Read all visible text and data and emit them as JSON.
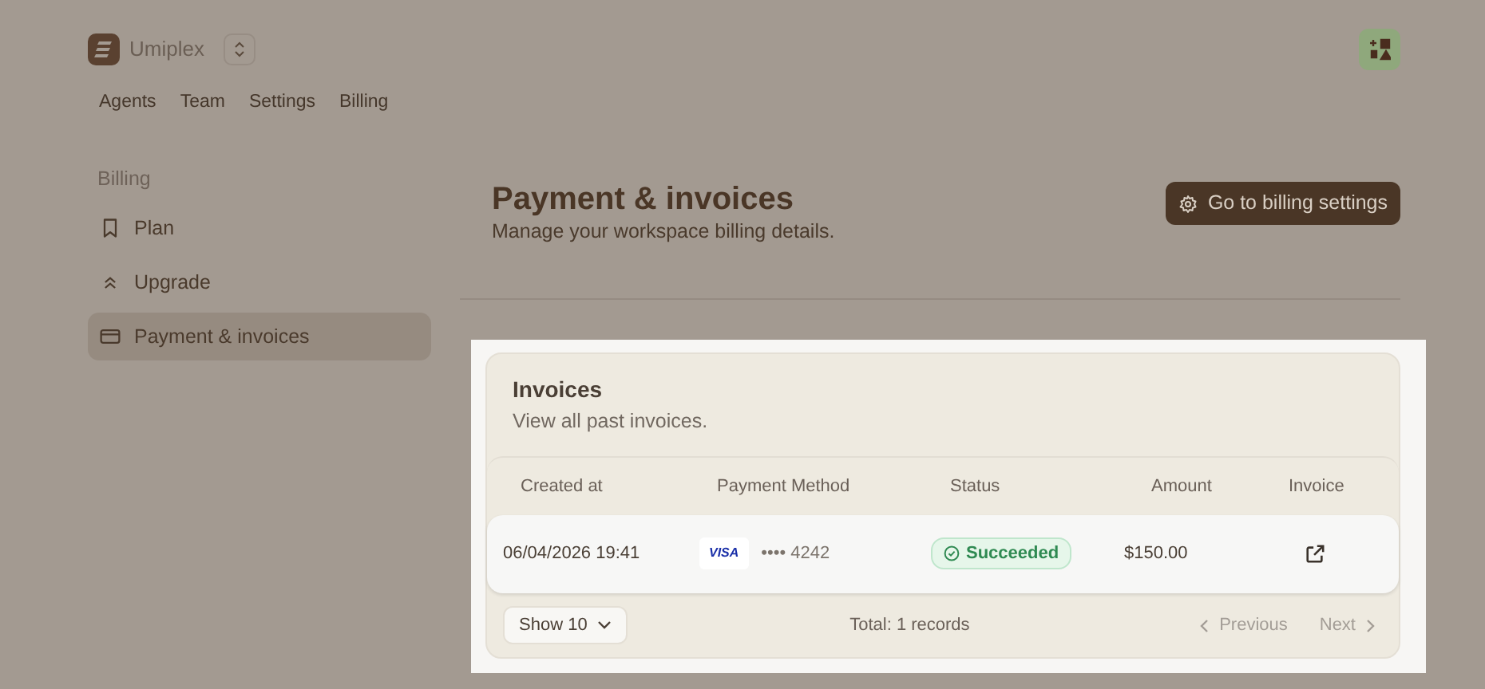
{
  "workspace": {
    "name": "Umiplex"
  },
  "top_nav": [
    {
      "label": "Agents"
    },
    {
      "label": "Team"
    },
    {
      "label": "Settings"
    },
    {
      "label": "Billing"
    }
  ],
  "sidebar": {
    "heading": "Billing",
    "items": [
      {
        "label": "Plan",
        "selected": false
      },
      {
        "label": "Upgrade",
        "selected": false
      },
      {
        "label": "Payment & invoices",
        "selected": true
      }
    ]
  },
  "page": {
    "title": "Payment & invoices",
    "subtitle": "Manage your workspace billing details.",
    "action": "Go to billing settings"
  },
  "invoices": {
    "title": "Invoices",
    "subtitle": "View all past invoices.",
    "columns": [
      "Created at",
      "Payment Method",
      "Status",
      "Amount",
      "Invoice"
    ],
    "rows": [
      {
        "created": "06/04/2026 19:41",
        "card_brand": "VISA",
        "card_number": "•••• 4242",
        "status": "Succeeded",
        "amount": "$150.00"
      }
    ],
    "page_size": "Show 10",
    "total": "Total: 1 records",
    "previous": {
      "label": "Previous",
      "disabled": true
    },
    "next": {
      "label": "Next",
      "disabled": true
    }
  }
}
